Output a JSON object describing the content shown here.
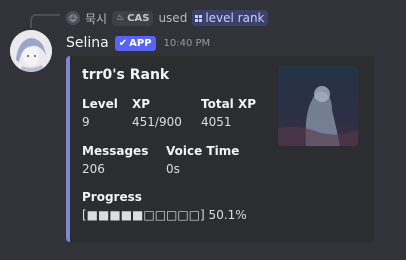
{
  "reply": {
    "author": "묵시",
    "tag": "CAS",
    "verb": "used",
    "command": "level rank"
  },
  "message": {
    "username": "Selina",
    "badge": "APP",
    "timestamp": "10:40 PM"
  },
  "embed": {
    "title": "trr0's Rank",
    "accent_color": "#7e86d8",
    "fields": {
      "level": {
        "name": "Level",
        "value": "9"
      },
      "xp": {
        "name": "XP",
        "value": "451/900"
      },
      "total_xp": {
        "name": "Total XP",
        "value": "4051"
      },
      "messages": {
        "name": "Messages",
        "value": "206"
      },
      "voice_time": {
        "name": "Voice Time",
        "value": "0s"
      },
      "progress": {
        "name": "Progress",
        "value": "[■■■■■□□□□□] 50.1%"
      }
    }
  }
}
